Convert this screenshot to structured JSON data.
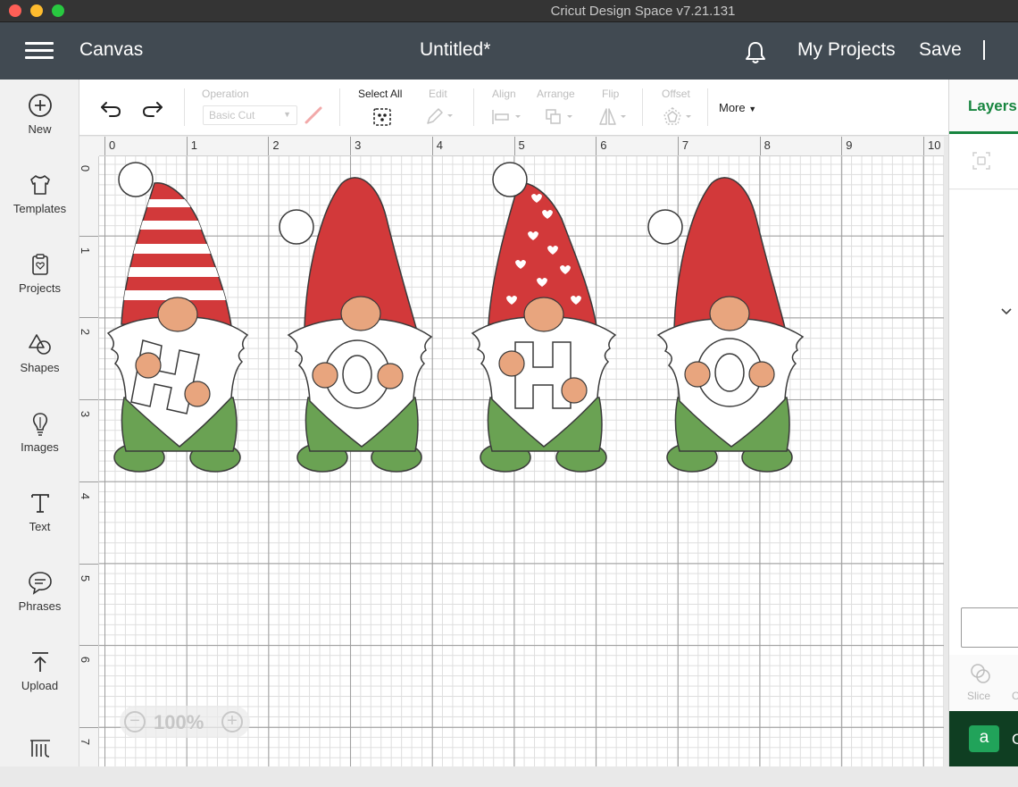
{
  "window": {
    "title": "Cricut Design Space  v7.21.131"
  },
  "header": {
    "section": "Canvas",
    "document_title": "Untitled*",
    "my_projects": "My Projects",
    "save": "Save"
  },
  "sidebar": {
    "items": [
      {
        "label": "New",
        "icon": "plus-circle-icon"
      },
      {
        "label": "Templates",
        "icon": "shirt-icon"
      },
      {
        "label": "Projects",
        "icon": "clipboard-icon"
      },
      {
        "label": "Shapes",
        "icon": "shapes-icon"
      },
      {
        "label": "Images",
        "icon": "lightbulb-icon"
      },
      {
        "label": "Text",
        "icon": "text-icon"
      },
      {
        "label": "Phrases",
        "icon": "speech-bubble-icon"
      },
      {
        "label": "Upload",
        "icon": "upload-icon"
      }
    ]
  },
  "toolbar": {
    "operation_label": "Operation",
    "operation_value": "Basic Cut",
    "select_all": "Select All",
    "edit": "Edit",
    "align": "Align",
    "arrange": "Arrange",
    "flip": "Flip",
    "offset": "Offset",
    "more": "More"
  },
  "ruler": {
    "top": [
      "0",
      "1",
      "2",
      "3",
      "4",
      "5",
      "6",
      "7",
      "8",
      "9",
      "10"
    ],
    "left": [
      "0",
      "1",
      "2",
      "3",
      "4",
      "5",
      "6",
      "7"
    ]
  },
  "canvas": {
    "letters": [
      "H",
      "O",
      "H",
      "O"
    ],
    "hats": [
      "striped",
      "solid",
      "hearts",
      "solid"
    ],
    "colors": {
      "hat_red": "#d2393a",
      "beard": "#ffffff",
      "nose_skin": "#e8a57e",
      "boots_green": "#6aa253",
      "outline": "#3a3a3a"
    }
  },
  "zoom": {
    "value": "100%"
  },
  "right_panel": {
    "tab": "Layers",
    "slice": "Slice",
    "next": "C",
    "chat_letter": "a"
  }
}
